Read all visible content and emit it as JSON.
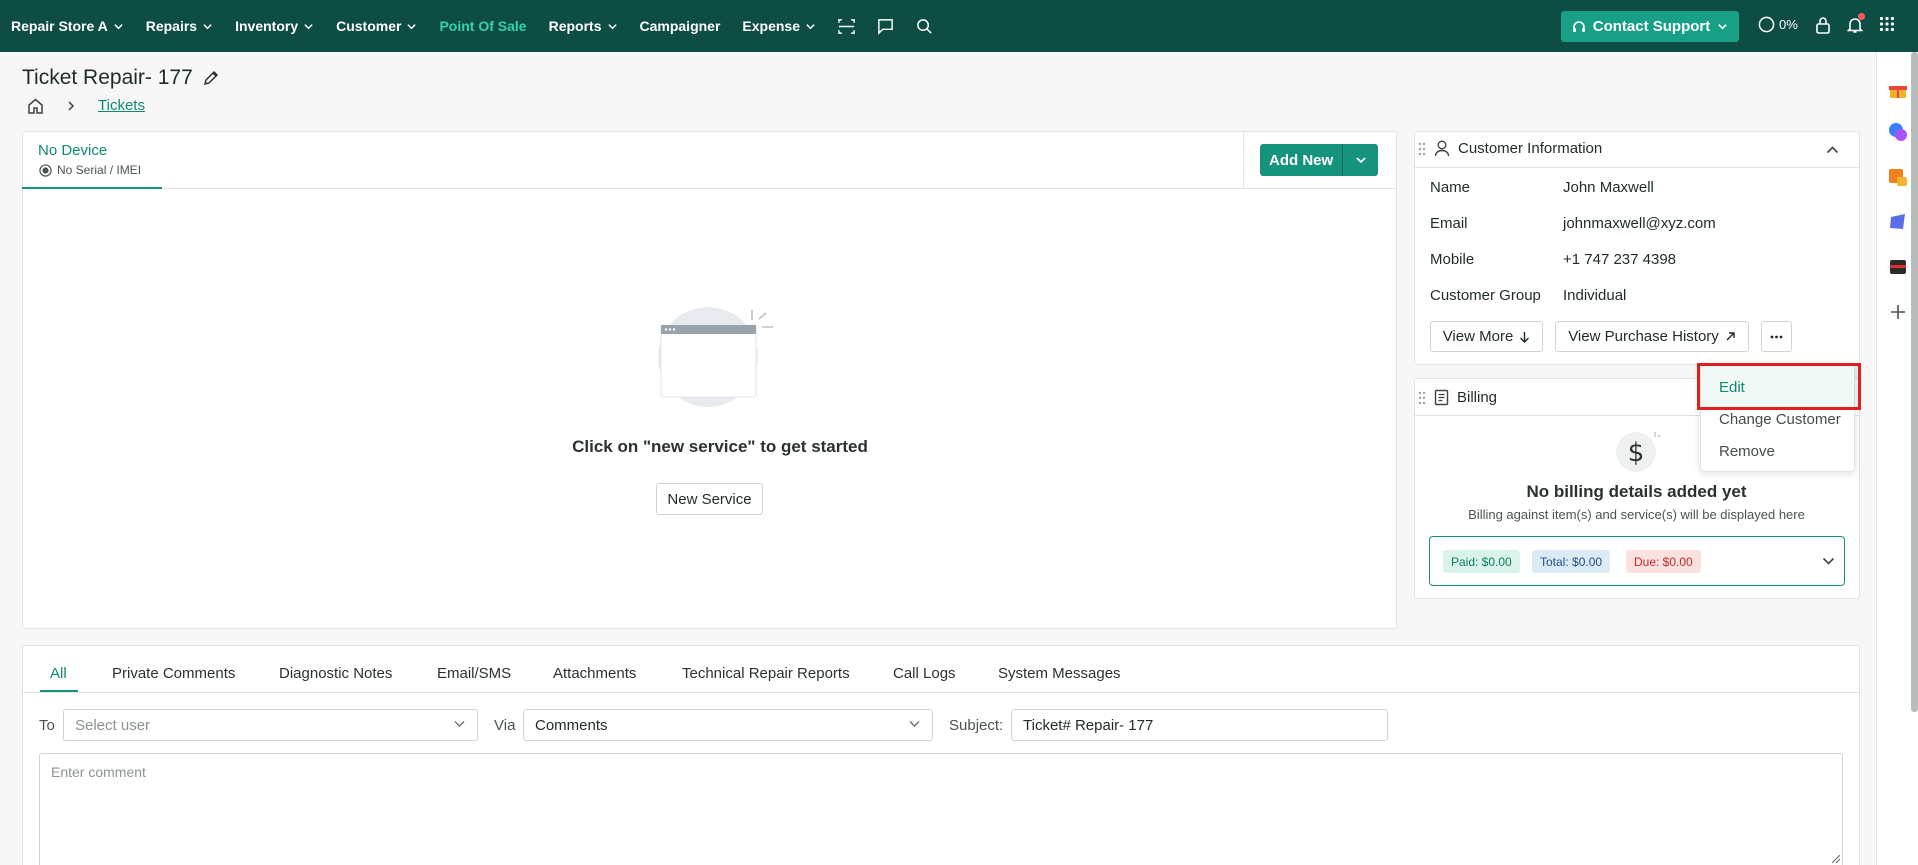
{
  "nav": {
    "store": "Repair Store A",
    "items": [
      "Repairs",
      "Inventory",
      "Customer"
    ],
    "pos": "Point Of Sale",
    "reports": "Reports",
    "campaigner": "Campaigner",
    "expense": "Expense",
    "support": "Contact Support",
    "percent": "0%",
    "accent": "#0e4d44"
  },
  "page": {
    "title": "Ticket Repair- 177",
    "breadcrumb": "Tickets"
  },
  "device": {
    "name": "No Device",
    "serial": "No Serial / IMEI",
    "add_new": "Add New",
    "empty_text": "Click on \"new service\" to get started",
    "new_service": "New Service"
  },
  "customer": {
    "title": "Customer Information",
    "labels": [
      "Name",
      "Email",
      "Mobile",
      "Customer Group"
    ],
    "values": [
      "John Maxwell",
      "johnmaxwell@xyz.com",
      "+1 747 237 4398",
      "Individual"
    ],
    "view_more": "View More",
    "purchase_history": "View Purchase History"
  },
  "menu": {
    "items": [
      "Edit",
      "Change Customer",
      "Remove"
    ]
  },
  "billing": {
    "title": "Billing",
    "empty_title": "No billing details added yet",
    "empty_sub": "Billing against item(s) and service(s) will be displayed here",
    "paid": "Paid: $0.00",
    "total": "Total: $0.00",
    "due": "Due: $0.00"
  },
  "comments": {
    "tabs": [
      "All",
      "Private Comments",
      "Diagnostic Notes",
      "Email/SMS",
      "Attachments",
      "Technical Repair Reports",
      "Call Logs",
      "System Messages"
    ],
    "to_label": "To",
    "to_placeholder": "Select user",
    "via_label": "Via",
    "via_value": "Comments",
    "subject_label": "Subject:",
    "subject_value": "Ticket# Repair- 177",
    "comment_placeholder": "Enter comment"
  }
}
